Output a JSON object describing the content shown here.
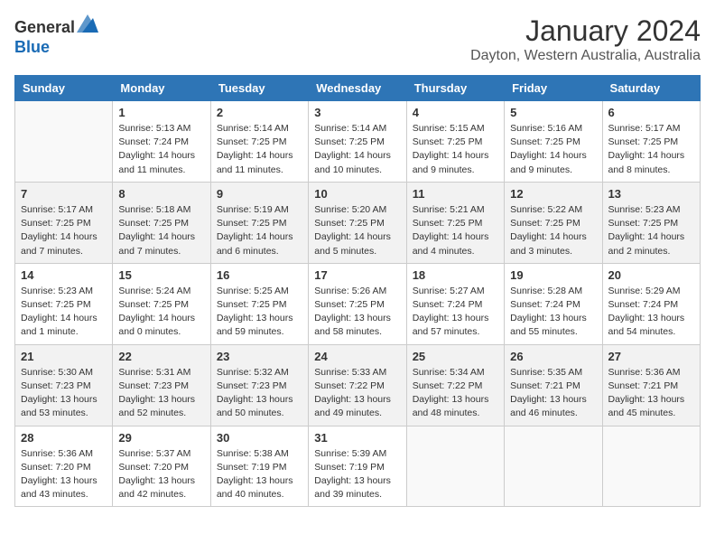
{
  "logo": {
    "general": "General",
    "blue": "Blue"
  },
  "header": {
    "month": "January 2024",
    "location": "Dayton, Western Australia, Australia"
  },
  "weekdays": [
    "Sunday",
    "Monday",
    "Tuesday",
    "Wednesday",
    "Thursday",
    "Friday",
    "Saturday"
  ],
  "weeks": [
    [
      {
        "day": "",
        "sunrise": "",
        "sunset": "",
        "daylight": ""
      },
      {
        "day": "1",
        "sunrise": "Sunrise: 5:13 AM",
        "sunset": "Sunset: 7:24 PM",
        "daylight": "Daylight: 14 hours and 11 minutes."
      },
      {
        "day": "2",
        "sunrise": "Sunrise: 5:14 AM",
        "sunset": "Sunset: 7:25 PM",
        "daylight": "Daylight: 14 hours and 11 minutes."
      },
      {
        "day": "3",
        "sunrise": "Sunrise: 5:14 AM",
        "sunset": "Sunset: 7:25 PM",
        "daylight": "Daylight: 14 hours and 10 minutes."
      },
      {
        "day": "4",
        "sunrise": "Sunrise: 5:15 AM",
        "sunset": "Sunset: 7:25 PM",
        "daylight": "Daylight: 14 hours and 9 minutes."
      },
      {
        "day": "5",
        "sunrise": "Sunrise: 5:16 AM",
        "sunset": "Sunset: 7:25 PM",
        "daylight": "Daylight: 14 hours and 9 minutes."
      },
      {
        "day": "6",
        "sunrise": "Sunrise: 5:17 AM",
        "sunset": "Sunset: 7:25 PM",
        "daylight": "Daylight: 14 hours and 8 minutes."
      }
    ],
    [
      {
        "day": "7",
        "sunrise": "Sunrise: 5:17 AM",
        "sunset": "Sunset: 7:25 PM",
        "daylight": "Daylight: 14 hours and 7 minutes."
      },
      {
        "day": "8",
        "sunrise": "Sunrise: 5:18 AM",
        "sunset": "Sunset: 7:25 PM",
        "daylight": "Daylight: 14 hours and 7 minutes."
      },
      {
        "day": "9",
        "sunrise": "Sunrise: 5:19 AM",
        "sunset": "Sunset: 7:25 PM",
        "daylight": "Daylight: 14 hours and 6 minutes."
      },
      {
        "day": "10",
        "sunrise": "Sunrise: 5:20 AM",
        "sunset": "Sunset: 7:25 PM",
        "daylight": "Daylight: 14 hours and 5 minutes."
      },
      {
        "day": "11",
        "sunrise": "Sunrise: 5:21 AM",
        "sunset": "Sunset: 7:25 PM",
        "daylight": "Daylight: 14 hours and 4 minutes."
      },
      {
        "day": "12",
        "sunrise": "Sunrise: 5:22 AM",
        "sunset": "Sunset: 7:25 PM",
        "daylight": "Daylight: 14 hours and 3 minutes."
      },
      {
        "day": "13",
        "sunrise": "Sunrise: 5:23 AM",
        "sunset": "Sunset: 7:25 PM",
        "daylight": "Daylight: 14 hours and 2 minutes."
      }
    ],
    [
      {
        "day": "14",
        "sunrise": "Sunrise: 5:23 AM",
        "sunset": "Sunset: 7:25 PM",
        "daylight": "Daylight: 14 hours and 1 minute."
      },
      {
        "day": "15",
        "sunrise": "Sunrise: 5:24 AM",
        "sunset": "Sunset: 7:25 PM",
        "daylight": "Daylight: 14 hours and 0 minutes."
      },
      {
        "day": "16",
        "sunrise": "Sunrise: 5:25 AM",
        "sunset": "Sunset: 7:25 PM",
        "daylight": "Daylight: 13 hours and 59 minutes."
      },
      {
        "day": "17",
        "sunrise": "Sunrise: 5:26 AM",
        "sunset": "Sunset: 7:25 PM",
        "daylight": "Daylight: 13 hours and 58 minutes."
      },
      {
        "day": "18",
        "sunrise": "Sunrise: 5:27 AM",
        "sunset": "Sunset: 7:24 PM",
        "daylight": "Daylight: 13 hours and 57 minutes."
      },
      {
        "day": "19",
        "sunrise": "Sunrise: 5:28 AM",
        "sunset": "Sunset: 7:24 PM",
        "daylight": "Daylight: 13 hours and 55 minutes."
      },
      {
        "day": "20",
        "sunrise": "Sunrise: 5:29 AM",
        "sunset": "Sunset: 7:24 PM",
        "daylight": "Daylight: 13 hours and 54 minutes."
      }
    ],
    [
      {
        "day": "21",
        "sunrise": "Sunrise: 5:30 AM",
        "sunset": "Sunset: 7:23 PM",
        "daylight": "Daylight: 13 hours and 53 minutes."
      },
      {
        "day": "22",
        "sunrise": "Sunrise: 5:31 AM",
        "sunset": "Sunset: 7:23 PM",
        "daylight": "Daylight: 13 hours and 52 minutes."
      },
      {
        "day": "23",
        "sunrise": "Sunrise: 5:32 AM",
        "sunset": "Sunset: 7:23 PM",
        "daylight": "Daylight: 13 hours and 50 minutes."
      },
      {
        "day": "24",
        "sunrise": "Sunrise: 5:33 AM",
        "sunset": "Sunset: 7:22 PM",
        "daylight": "Daylight: 13 hours and 49 minutes."
      },
      {
        "day": "25",
        "sunrise": "Sunrise: 5:34 AM",
        "sunset": "Sunset: 7:22 PM",
        "daylight": "Daylight: 13 hours and 48 minutes."
      },
      {
        "day": "26",
        "sunrise": "Sunrise: 5:35 AM",
        "sunset": "Sunset: 7:21 PM",
        "daylight": "Daylight: 13 hours and 46 minutes."
      },
      {
        "day": "27",
        "sunrise": "Sunrise: 5:36 AM",
        "sunset": "Sunset: 7:21 PM",
        "daylight": "Daylight: 13 hours and 45 minutes."
      }
    ],
    [
      {
        "day": "28",
        "sunrise": "Sunrise: 5:36 AM",
        "sunset": "Sunset: 7:20 PM",
        "daylight": "Daylight: 13 hours and 43 minutes."
      },
      {
        "day": "29",
        "sunrise": "Sunrise: 5:37 AM",
        "sunset": "Sunset: 7:20 PM",
        "daylight": "Daylight: 13 hours and 42 minutes."
      },
      {
        "day": "30",
        "sunrise": "Sunrise: 5:38 AM",
        "sunset": "Sunset: 7:19 PM",
        "daylight": "Daylight: 13 hours and 40 minutes."
      },
      {
        "day": "31",
        "sunrise": "Sunrise: 5:39 AM",
        "sunset": "Sunset: 7:19 PM",
        "daylight": "Daylight: 13 hours and 39 minutes."
      },
      {
        "day": "",
        "sunrise": "",
        "sunset": "",
        "daylight": ""
      },
      {
        "day": "",
        "sunrise": "",
        "sunset": "",
        "daylight": ""
      },
      {
        "day": "",
        "sunrise": "",
        "sunset": "",
        "daylight": ""
      }
    ]
  ]
}
